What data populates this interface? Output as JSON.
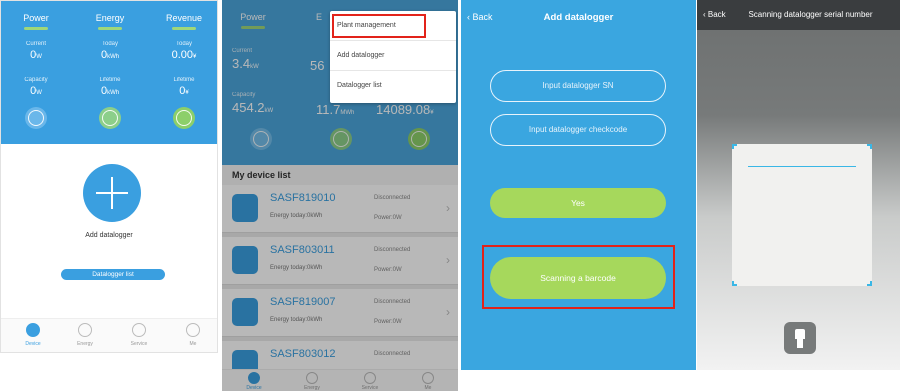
{
  "panel1": {
    "tabs": [
      "Power",
      "Energy",
      "Revenue"
    ],
    "stats_row1": [
      {
        "label": "Current",
        "value": "0",
        "unit": "W"
      },
      {
        "label": "Today",
        "value": "0",
        "unit": "kWh"
      },
      {
        "label": "Today",
        "value": "0.00",
        "unit": "¥"
      }
    ],
    "stats_row2": [
      {
        "label": "Capacity",
        "value": "0",
        "unit": "W"
      },
      {
        "label": "Lifetime",
        "value": "0",
        "unit": "kWh"
      },
      {
        "label": "Lifetime",
        "value": "0",
        "unit": "¥"
      }
    ],
    "add_label": "Add datalogger",
    "list_button": "Datalogger list",
    "nav": [
      "Device",
      "Energy",
      "Service",
      "Me"
    ]
  },
  "panel2": {
    "tabs": [
      "Power",
      "E"
    ],
    "stats_row1": [
      {
        "label": "Current",
        "value": "3.4",
        "unit": "kW"
      },
      {
        "label": "",
        "value": "56",
        "unit": ""
      }
    ],
    "stats_row2": [
      {
        "label": "Capacity",
        "value": "454.2",
        "unit": "kW"
      },
      {
        "label": "",
        "value": "11.7",
        "unit": "MWh"
      },
      {
        "label": "",
        "value": "14089.08",
        "unit": "¥"
      }
    ],
    "menu": [
      "Plant management",
      "Add datalogger",
      "Datalogger list"
    ],
    "list_title": "My device list",
    "devices": [
      {
        "sn": "SASF819010",
        "energy": "Energy today:0kWh",
        "status": "Disconnected",
        "power": "Power:0W"
      },
      {
        "sn": "SASF803011",
        "energy": "Energy today:0kWh",
        "status": "Disconnected",
        "power": "Power:0W"
      },
      {
        "sn": "SASF819007",
        "energy": "Energy today:0kWh",
        "status": "Disconnected",
        "power": "Power:0W"
      },
      {
        "sn": "SASF803012",
        "energy": "",
        "status": "Disconnected",
        "power": ""
      }
    ],
    "nav": [
      "Device",
      "Energy",
      "Service",
      "Me"
    ]
  },
  "panel3": {
    "back": "Back",
    "title": "Add datalogger",
    "input_sn": "Input datalogger SN",
    "input_checkcode": "Input datalogger checkcode",
    "yes": "Yes",
    "scan": "Scanning a barcode"
  },
  "panel4": {
    "back": "Back",
    "title": "Scanning datalogger serial number"
  },
  "colors": {
    "primary_blue": "#3a9fe0",
    "green": "#a6d85c",
    "highlight_red": "#e2231a"
  }
}
